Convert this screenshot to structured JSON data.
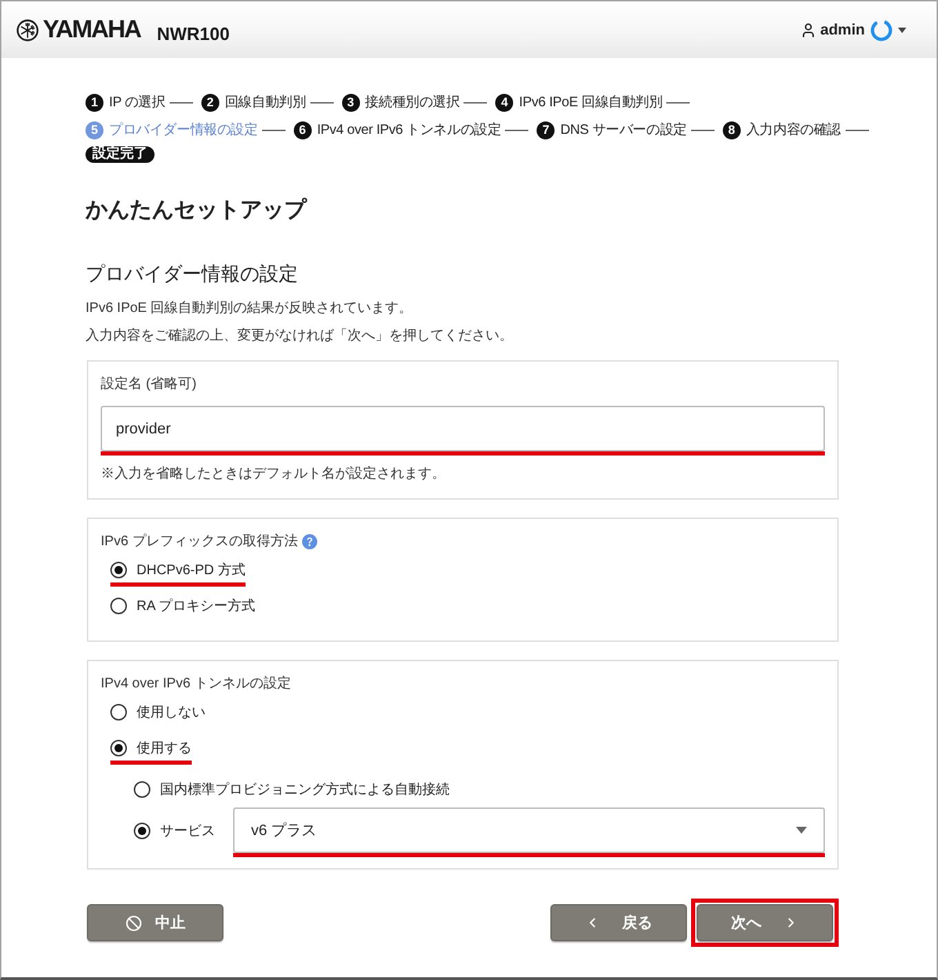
{
  "header": {
    "brand": "YAMAHA",
    "model": "NWR100",
    "user": "admin"
  },
  "steps": [
    {
      "number": "1",
      "label": "IP の選択",
      "selected": false
    },
    {
      "number": "2",
      "label": "回線自動判別",
      "selected": false
    },
    {
      "number": "3",
      "label": "接続種別の選択",
      "selected": false
    },
    {
      "number": "4",
      "label": "IPv6 IPoE 回線自動判別",
      "selected": false
    },
    {
      "number": "5",
      "label": "プロバイダー情報の設定",
      "selected": true
    },
    {
      "number": "6",
      "label": "IPv4 over IPv6 トンネルの設定",
      "selected": false
    },
    {
      "number": "7",
      "label": "DNS サーバーの設定",
      "selected": false
    },
    {
      "number": "8",
      "label": "入力内容の確認",
      "selected": false
    }
  ],
  "steps_done_badge": "設定完了",
  "page_title": "かんたんセットアップ",
  "section": {
    "title": "プロバイダー情報の設定",
    "description": [
      "IPv6 IPoE 回線自動判別の結果が反映されています。",
      "入力内容をご確認の上、変更がなければ「次へ」を押してください。"
    ]
  },
  "cards": [
    {
      "kind": "text",
      "label": "設定名 (省略可)",
      "value": "provider",
      "highlighted": true,
      "note": "※入力を省略したときはデフォルト名が設定されます。"
    },
    {
      "kind": "radio",
      "label": "IPv6 プレフィックスの取得方法",
      "help": true,
      "options": [
        {
          "label": "DHCPv6-PD 方式",
          "selected": true,
          "highlighted": true
        },
        {
          "label": "RA プロキシー方式",
          "selected": false,
          "highlighted": false
        }
      ]
    },
    {
      "kind": "radio",
      "label": "IPv4 over IPv6 トンネルの設定",
      "options": [
        {
          "label": "使用しない",
          "selected": false,
          "highlighted": false
        },
        {
          "label": "使用する",
          "selected": true,
          "highlighted": true,
          "children": [
            {
              "label": "国内標準プロビジョニング方式による自動接続",
              "selected": false
            },
            {
              "label": "サービス",
              "selected": true,
              "select": {
                "value": "v6 プラス",
                "highlighted": true
              }
            }
          ]
        }
      ]
    }
  ],
  "buttons": [
    {
      "kind": "cancel",
      "label": "中止",
      "highlighted": false
    },
    {
      "kind": "back",
      "label": "戻る",
      "highlighted": false
    },
    {
      "kind": "next",
      "label": "次へ",
      "highlighted": true
    }
  ]
}
